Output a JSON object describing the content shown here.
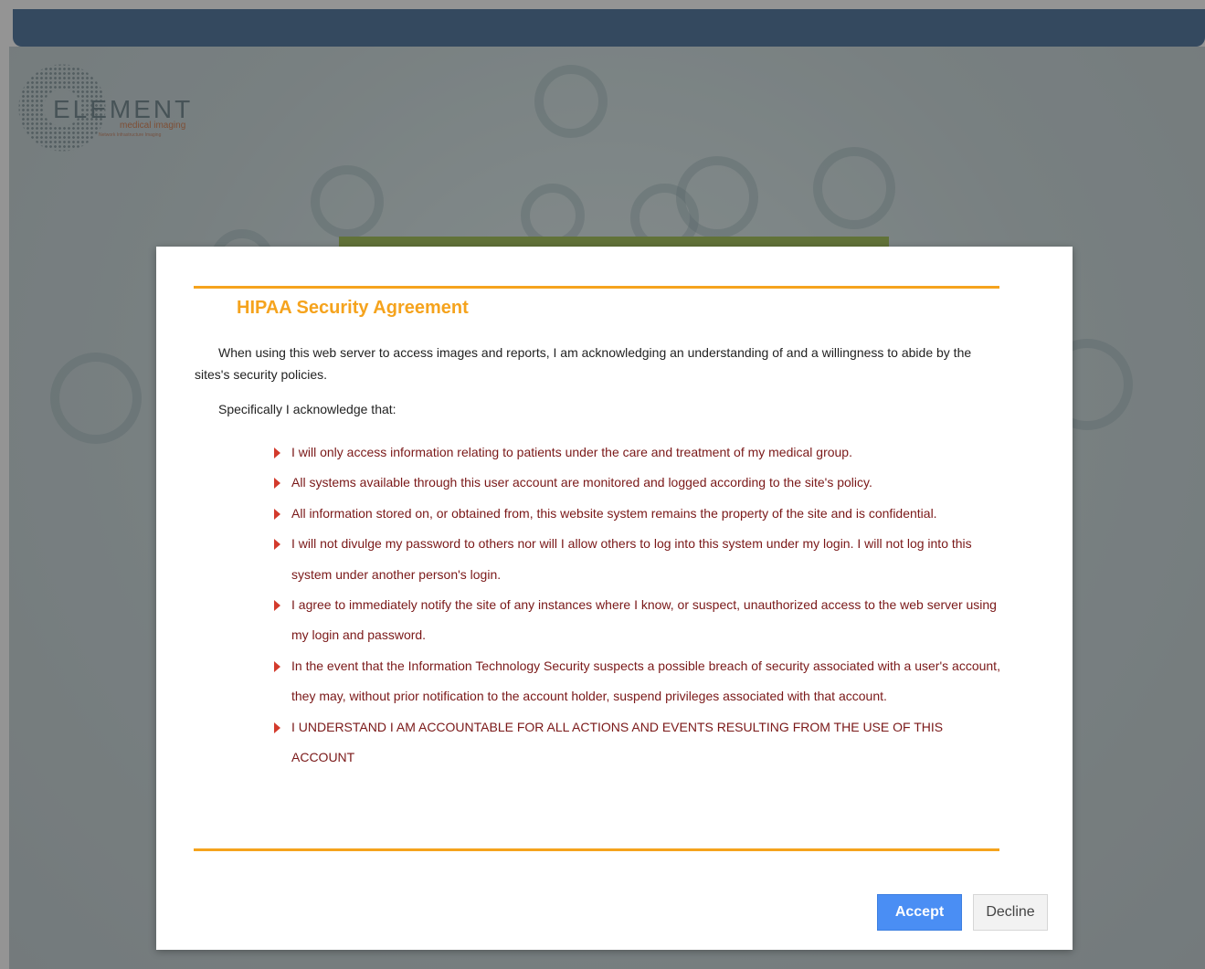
{
  "logo": {
    "word": "ELEMENT",
    "sub": "medical imaging",
    "tag": "Network Infrastructure Imaging"
  },
  "modal": {
    "title": "HIPAA Security Agreement",
    "intro": "When using this web server to access images and reports, I am acknowledging an understanding of and a willingness to abide by the sites's security policies.",
    "lead": "Specifically I acknowledge that:",
    "terms": [
      "I will only access information relating to patients under the care and treatment of my medical group.",
      "All systems available through this user account are monitored and logged according to the site's policy.",
      "All information stored on, or obtained from, this website system remains the property of the site and is confidential.",
      "I will not divulge my password to others nor will I allow others to log into this system under my login. I will not log into this system under another person's login.",
      "I agree to immediately notify the site of any instances where I know, or suspect, unauthorized access to the web server using my login and password.",
      "In the event that the Information Technology Security suspects a possible breach of security associated with a user's account, they may, without prior notification to the account holder, suspend privileges associated with that account.",
      "I UNDERSTAND I AM ACCOUNTABLE FOR ALL ACTIONS AND EVENTS RESULTING FROM THE USE OF THIS ACCOUNT"
    ],
    "accept_label": "Accept",
    "decline_label": "Decline"
  },
  "colors": {
    "accent": "#f5a31d",
    "header": "#5a7ea4",
    "primary_button": "#4a8ef4",
    "term_text": "#7a1818",
    "bullet": "#d33a2c"
  }
}
